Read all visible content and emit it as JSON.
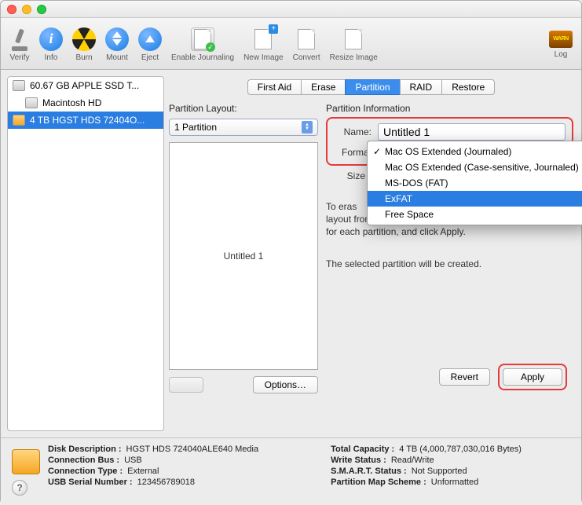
{
  "toolbar": {
    "verify": "Verify",
    "info": "Info",
    "burn": "Burn",
    "mount": "Mount",
    "eject": "Eject",
    "enable_journaling": "Enable Journaling",
    "new_image": "New Image",
    "convert": "Convert",
    "resize_image": "Resize Image",
    "log": "Log"
  },
  "sidebar": {
    "items": [
      {
        "label": "60.67 GB APPLE SSD T..."
      },
      {
        "label": "Macintosh HD"
      },
      {
        "label": "4 TB HGST HDS 72404O..."
      }
    ]
  },
  "tabs": {
    "first_aid": "First Aid",
    "erase": "Erase",
    "partition": "Partition",
    "raid": "RAID",
    "restore": "Restore"
  },
  "left": {
    "layout_label": "Partition Layout:",
    "layout_value": "1 Partition",
    "partition_name": "Untitled 1",
    "options_btn": "Options…"
  },
  "right": {
    "heading": "Partition Information",
    "name_label": "Name:",
    "name_value": "Untitled 1",
    "format_label": "Format",
    "size_label": "Size",
    "format_options": [
      "Mac OS Extended (Journaled)",
      "Mac OS Extended (Case-sensitive, Journaled)",
      "MS-DOS (FAT)",
      "ExFAT",
      "Free Space"
    ],
    "instr1_prefix": "To eras",
    "instr2": "layout from the Partition Layout pop-up menu, set options for each partition, and click Apply.",
    "instr3": "The selected partition will be created.",
    "revert": "Revert",
    "apply": "Apply"
  },
  "footer": {
    "k_desc": "Disk Description :",
    "v_desc": "HGST HDS 724040ALE640 Media",
    "k_cap": "Total Capacity :",
    "v_cap": "4 TB (4,000,787,030,016 Bytes)",
    "k_bus": "Connection Bus :",
    "v_bus": "USB",
    "k_ws": "Write Status :",
    "v_ws": "Read/Write",
    "k_ct": "Connection Type :",
    "v_ct": "External",
    "k_smart": "S.M.A.R.T. Status :",
    "v_smart": "Not Supported",
    "k_usb": "USB Serial Number :",
    "v_usb": "123456789018",
    "k_pms": "Partition Map Scheme :",
    "v_pms": "Unformatted"
  }
}
